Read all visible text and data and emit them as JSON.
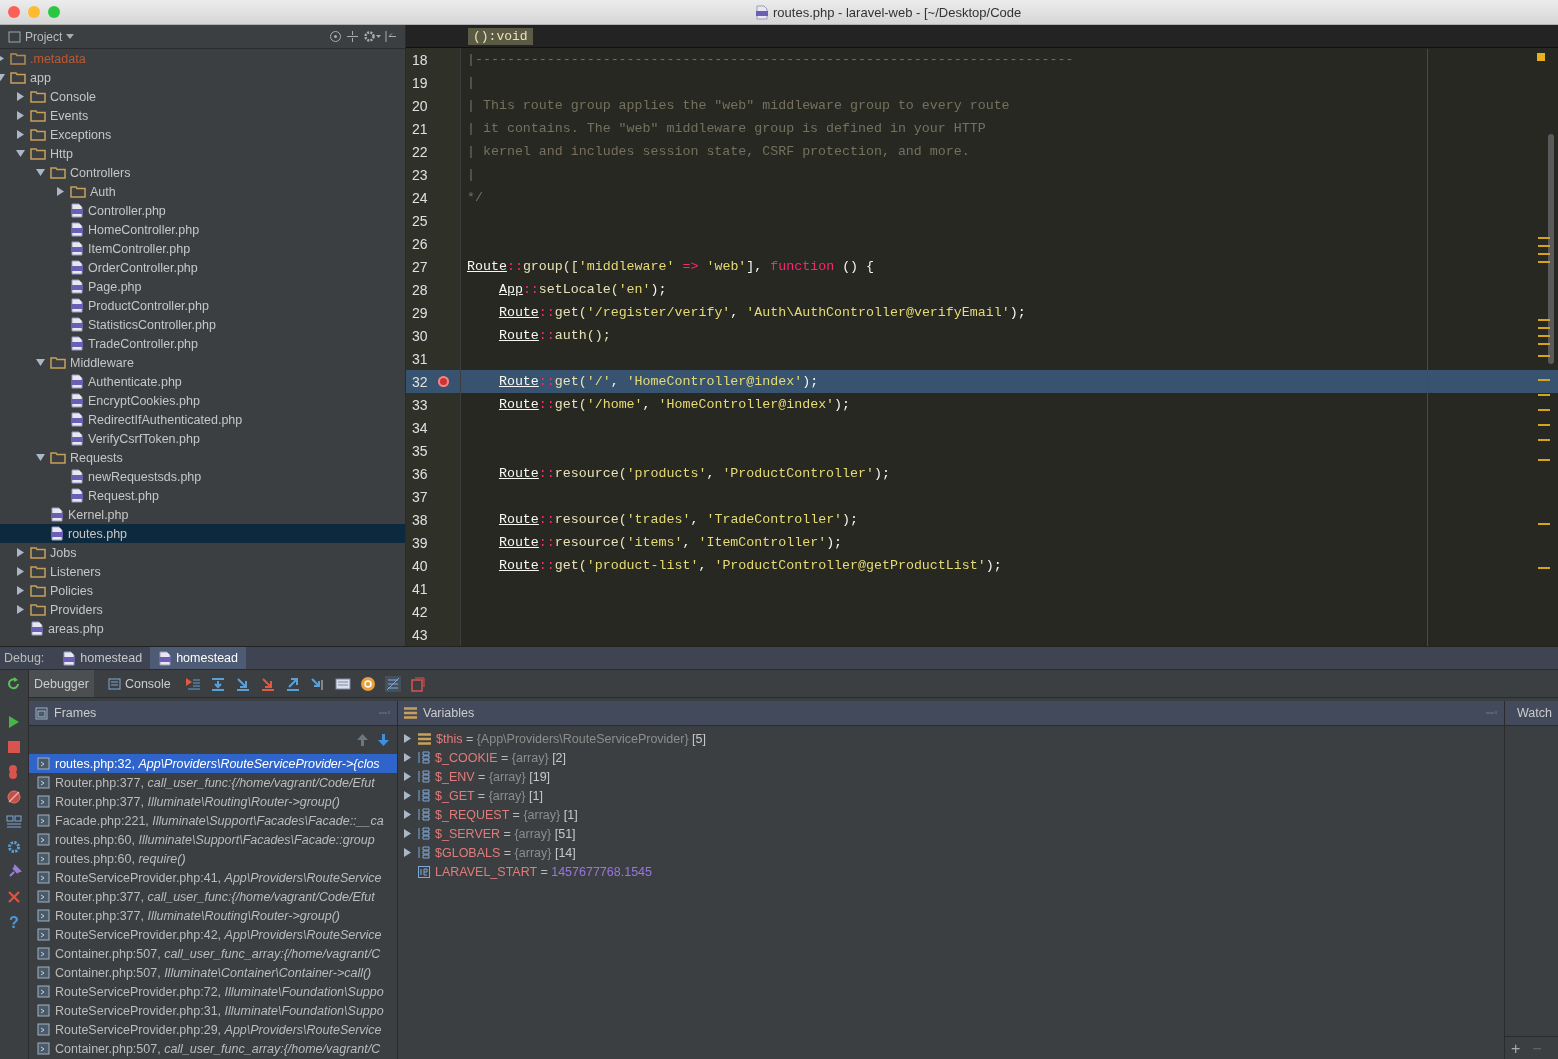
{
  "window": {
    "title": "routes.php - laravel-web - [~/Desktop/Code"
  },
  "project": {
    "title": "Project",
    "tree": [
      {
        "name": ".metadata",
        "kind": "excluded",
        "expanded": false,
        "selected": false
      },
      {
        "name": "app",
        "kind": "folder",
        "expanded": true,
        "selected": false,
        "children": [
          {
            "name": "Console",
            "kind": "folder",
            "expanded": false,
            "selected": false
          },
          {
            "name": "Events",
            "kind": "folder",
            "expanded": false,
            "selected": false
          },
          {
            "name": "Exceptions",
            "kind": "folder",
            "expanded": false,
            "selected": false
          },
          {
            "name": "Http",
            "kind": "folder",
            "expanded": true,
            "selected": false,
            "children": [
              {
                "name": "Controllers",
                "kind": "folder",
                "expanded": true,
                "selected": false,
                "children": [
                  {
                    "name": "Auth",
                    "kind": "folder",
                    "expanded": false,
                    "selected": false
                  },
                  {
                    "name": "Controller.php",
                    "kind": "file",
                    "selected": false
                  },
                  {
                    "name": "HomeController.php",
                    "kind": "file",
                    "selected": false
                  },
                  {
                    "name": "ItemController.php",
                    "kind": "file",
                    "selected": false
                  },
                  {
                    "name": "OrderController.php",
                    "kind": "file",
                    "selected": false
                  },
                  {
                    "name": "Page.php",
                    "kind": "file",
                    "selected": false
                  },
                  {
                    "name": "ProductController.php",
                    "kind": "file",
                    "selected": false
                  },
                  {
                    "name": "StatisticsController.php",
                    "kind": "file",
                    "selected": false
                  },
                  {
                    "name": "TradeController.php",
                    "kind": "file",
                    "selected": false
                  }
                ]
              },
              {
                "name": "Middleware",
                "kind": "folder",
                "expanded": true,
                "selected": false,
                "children": [
                  {
                    "name": "Authenticate.php",
                    "kind": "file",
                    "selected": false
                  },
                  {
                    "name": "EncryptCookies.php",
                    "kind": "file",
                    "selected": false
                  },
                  {
                    "name": "RedirectIfAuthenticated.php",
                    "kind": "file",
                    "selected": false
                  },
                  {
                    "name": "VerifyCsrfToken.php",
                    "kind": "file",
                    "selected": false
                  }
                ]
              },
              {
                "name": "Requests",
                "kind": "folder",
                "expanded": true,
                "selected": false,
                "children": [
                  {
                    "name": "newRequestsds.php",
                    "kind": "file",
                    "selected": false
                  },
                  {
                    "name": "Request.php",
                    "kind": "file",
                    "selected": false
                  }
                ]
              },
              {
                "name": "Kernel.php",
                "kind": "file",
                "selected": false
              },
              {
                "name": "routes.php",
                "kind": "file",
                "selected": true
              }
            ]
          },
          {
            "name": "Jobs",
            "kind": "folder",
            "expanded": false,
            "selected": false
          },
          {
            "name": "Listeners",
            "kind": "folder",
            "expanded": false,
            "selected": false
          },
          {
            "name": "Policies",
            "kind": "folder",
            "expanded": false,
            "selected": false
          },
          {
            "name": "Providers",
            "kind": "folder",
            "expanded": false,
            "selected": false
          },
          {
            "name": "areas.php",
            "kind": "file",
            "selected": false
          }
        ]
      }
    ]
  },
  "editor": {
    "breadcrumb": "():void",
    "lines": [
      {
        "number": "18",
        "current": false,
        "breakpoint": false,
        "tokens": [
          {
            "kind": "comment",
            "text": "|---------------------------------------------------------------------------"
          }
        ]
      },
      {
        "number": "19",
        "current": false,
        "breakpoint": false,
        "tokens": [
          {
            "kind": "comment",
            "text": "|"
          }
        ]
      },
      {
        "number": "20",
        "current": false,
        "breakpoint": false,
        "tokens": [
          {
            "kind": "comment",
            "text": "| This route group applies the \"web\" middleware group to every route"
          }
        ]
      },
      {
        "number": "21",
        "current": false,
        "breakpoint": false,
        "tokens": [
          {
            "kind": "comment",
            "text": "| it contains. The \"web\" middleware group is defined in your HTTP"
          }
        ]
      },
      {
        "number": "22",
        "current": false,
        "breakpoint": false,
        "tokens": [
          {
            "kind": "comment",
            "text": "| kernel and includes session state, CSRF protection, and more."
          }
        ]
      },
      {
        "number": "23",
        "current": false,
        "breakpoint": false,
        "tokens": [
          {
            "kind": "comment",
            "text": "|"
          }
        ]
      },
      {
        "number": "24",
        "current": false,
        "breakpoint": false,
        "tokens": [
          {
            "kind": "comment",
            "text": "*/"
          }
        ]
      },
      {
        "number": "25",
        "current": false,
        "breakpoint": false
      },
      {
        "number": "26",
        "current": false,
        "breakpoint": false
      },
      {
        "number": "27",
        "current": false,
        "breakpoint": false,
        "tokens": [
          {
            "kind": "class",
            "text": "Route"
          },
          {
            "kind": "op",
            "text": "::"
          },
          {
            "kind": "method",
            "text": "group(["
          },
          {
            "kind": "string",
            "text": "'middleware'"
          },
          {
            "kind": "op",
            "text": " => "
          },
          {
            "kind": "string",
            "text": "'web'"
          },
          {
            "kind": "plain",
            "text": "], "
          },
          {
            "kind": "keyword",
            "text": "function"
          },
          {
            "kind": "plain",
            "text": " () {"
          }
        ]
      },
      {
        "number": "28",
        "current": false,
        "breakpoint": false,
        "tokens": [
          {
            "kind": "class",
            "text": "    App"
          },
          {
            "kind": "op",
            "text": "::"
          },
          {
            "kind": "method",
            "text": "setLocale("
          },
          {
            "kind": "string",
            "text": "'en'"
          },
          {
            "kind": "plain",
            "text": ");"
          }
        ]
      },
      {
        "number": "29",
        "current": false,
        "breakpoint": false,
        "tokens": [
          {
            "kind": "class",
            "text": "    Route"
          },
          {
            "kind": "op",
            "text": "::"
          },
          {
            "kind": "method",
            "text": "get("
          },
          {
            "kind": "string",
            "text": "'/register/verify'"
          },
          {
            "kind": "plain",
            "text": ", "
          },
          {
            "kind": "string",
            "text": "'Auth\\AuthController@verifyEmail'"
          },
          {
            "kind": "plain",
            "text": ");"
          }
        ]
      },
      {
        "number": "30",
        "current": false,
        "breakpoint": false,
        "tokens": [
          {
            "kind": "class",
            "text": "    Route"
          },
          {
            "kind": "op",
            "text": "::"
          },
          {
            "kind": "method",
            "text": "auth();"
          }
        ]
      },
      {
        "number": "31",
        "current": false,
        "breakpoint": false
      },
      {
        "number": "32",
        "current": true,
        "breakpoint": true,
        "tokens": [
          {
            "kind": "class",
            "text": "    Route"
          },
          {
            "kind": "op",
            "text": "::"
          },
          {
            "kind": "method",
            "text": "get("
          },
          {
            "kind": "string",
            "text": "'/'"
          },
          {
            "kind": "plain",
            "text": ", "
          },
          {
            "kind": "string",
            "text": "'HomeController@index'"
          },
          {
            "kind": "plain",
            "text": ");"
          }
        ]
      },
      {
        "number": "33",
        "current": false,
        "breakpoint": false,
        "tokens": [
          {
            "kind": "class",
            "text": "    Route"
          },
          {
            "kind": "op",
            "text": "::"
          },
          {
            "kind": "method",
            "text": "get("
          },
          {
            "kind": "string",
            "text": "'/home'"
          },
          {
            "kind": "plain",
            "text": ", "
          },
          {
            "kind": "string",
            "text": "'HomeController@index'"
          },
          {
            "kind": "plain",
            "text": ");"
          }
        ]
      },
      {
        "number": "34",
        "current": false,
        "breakpoint": false
      },
      {
        "number": "35",
        "current": false,
        "breakpoint": false
      },
      {
        "number": "36",
        "current": false,
        "breakpoint": false,
        "tokens": [
          {
            "kind": "class",
            "text": "    Route"
          },
          {
            "kind": "op",
            "text": "::"
          },
          {
            "kind": "method",
            "text": "resource("
          },
          {
            "kind": "string",
            "text": "'products'"
          },
          {
            "kind": "plain",
            "text": ", "
          },
          {
            "kind": "string",
            "text": "'ProductController'"
          },
          {
            "kind": "plain",
            "text": ");"
          }
        ]
      },
      {
        "number": "37",
        "current": false,
        "breakpoint": false
      },
      {
        "number": "38",
        "current": false,
        "breakpoint": false,
        "tokens": [
          {
            "kind": "class",
            "text": "    Route"
          },
          {
            "kind": "op",
            "text": "::"
          },
          {
            "kind": "method",
            "text": "resource("
          },
          {
            "kind": "string",
            "text": "'trades'"
          },
          {
            "kind": "plain",
            "text": ", "
          },
          {
            "kind": "string",
            "text": "'TradeController'"
          },
          {
            "kind": "plain",
            "text": ");"
          }
        ]
      },
      {
        "number": "39",
        "current": false,
        "breakpoint": false,
        "tokens": [
          {
            "kind": "class",
            "text": "    Route"
          },
          {
            "kind": "op",
            "text": "::"
          },
          {
            "kind": "method",
            "text": "resource("
          },
          {
            "kind": "string",
            "text": "'items'"
          },
          {
            "kind": "plain",
            "text": ", "
          },
          {
            "kind": "string",
            "text": "'ItemController'"
          },
          {
            "kind": "plain",
            "text": ");"
          }
        ]
      },
      {
        "number": "40",
        "current": false,
        "breakpoint": false,
        "tokens": [
          {
            "kind": "class",
            "text": "    Route"
          },
          {
            "kind": "op",
            "text": "::"
          },
          {
            "kind": "method",
            "text": "get("
          },
          {
            "kind": "string",
            "text": "'product-list'"
          },
          {
            "kind": "plain",
            "text": ", "
          },
          {
            "kind": "string",
            "text": "'ProductController@getProductList'"
          },
          {
            "kind": "plain",
            "text": ");"
          }
        ]
      },
      {
        "number": "41",
        "current": false,
        "breakpoint": false
      },
      {
        "number": "42",
        "current": false,
        "breakpoint": false
      },
      {
        "number": "43",
        "current": false,
        "breakpoint": false
      }
    ]
  },
  "debug": {
    "label": "Debug:",
    "sessions": [
      {
        "name": "homestead",
        "selected": false
      },
      {
        "name": "homestead",
        "selected": true
      }
    ],
    "tabs": [
      {
        "label": "Debugger",
        "selected": true
      },
      {
        "label": "Console",
        "selected": false
      }
    ],
    "help": "?",
    "frames": {
      "title": "Frames",
      "items": [
        {
          "text": "routes.php:32, *App\\Providers\\RouteServiceProvider->{clos*",
          "selected": true
        },
        {
          "text": "Router.php:377, *call_user_func:{/home/vagrant/Code/Efut*",
          "selected": false
        },
        {
          "text": "Router.php:377, *Illuminate\\Routing\\Router->group()*",
          "selected": false
        },
        {
          "text": "Facade.php:221, *Illuminate\\Support\\Facades\\Facade::__ca*",
          "selected": false
        },
        {
          "text": "routes.php:60, *Illuminate\\Support\\Facades\\Facade::group*",
          "selected": false
        },
        {
          "text": "routes.php:60, *require()*",
          "selected": false
        },
        {
          "text": "RouteServiceProvider.php:41, *App\\Providers\\RouteService*",
          "selected": false
        },
        {
          "text": "Router.php:377, *call_user_func:{/home/vagrant/Code/Efut*",
          "selected": false
        },
        {
          "text": "Router.php:377, *Illuminate\\Routing\\Router->group()*",
          "selected": false
        },
        {
          "text": "RouteServiceProvider.php:42, *App\\Providers\\RouteService*",
          "selected": false
        },
        {
          "text": "Container.php:507, *call_user_func_array:{/home/vagrant/C*",
          "selected": false
        },
        {
          "text": "Container.php:507, *Illuminate\\Container\\Container->call()*",
          "selected": false
        },
        {
          "text": "RouteServiceProvider.php:72, *Illuminate\\Foundation\\Suppo*",
          "selected": false
        },
        {
          "text": "RouteServiceProvider.php:31, *Illuminate\\Foundation\\Suppo*",
          "selected": false
        },
        {
          "text": "RouteServiceProvider.php:29, *App\\Providers\\RouteService*",
          "selected": false
        },
        {
          "text": "Container.php:507, *call_user_func_array:{/home/vagrant/C*",
          "selected": false
        }
      ]
    },
    "variables": {
      "title": "Variables",
      "items": [
        {
          "kind": "object",
          "name": "$this",
          "operator": "=",
          "type": "{App\\Providers\\RouteServiceProvider}",
          "count": "[5]"
        },
        {
          "kind": "array",
          "name": "$_COOKIE",
          "operator": "=",
          "type": "{array}",
          "count": "[2]"
        },
        {
          "kind": "array",
          "name": "$_ENV",
          "operator": "=",
          "type": "{array}",
          "count": "[19]"
        },
        {
          "kind": "array",
          "name": "$_GET",
          "operator": "=",
          "type": "{array}",
          "count": "[1]"
        },
        {
          "kind": "array",
          "name": "$_REQUEST",
          "operator": "=",
          "type": "{array}",
          "count": "[1]"
        },
        {
          "kind": "array",
          "name": "$_SERVER",
          "operator": "=",
          "type": "{array}",
          "count": "[51]"
        },
        {
          "kind": "array",
          "name": "$GLOBALS",
          "operator": "=",
          "type": "{array}",
          "count": "[14]"
        },
        {
          "kind": "constant",
          "name": "LARAVEL_START",
          "operator": "=",
          "value": "1457677768.1545"
        }
      ]
    },
    "watches": {
      "title": "Watch",
      "add": "+",
      "remove": "−"
    }
  }
}
